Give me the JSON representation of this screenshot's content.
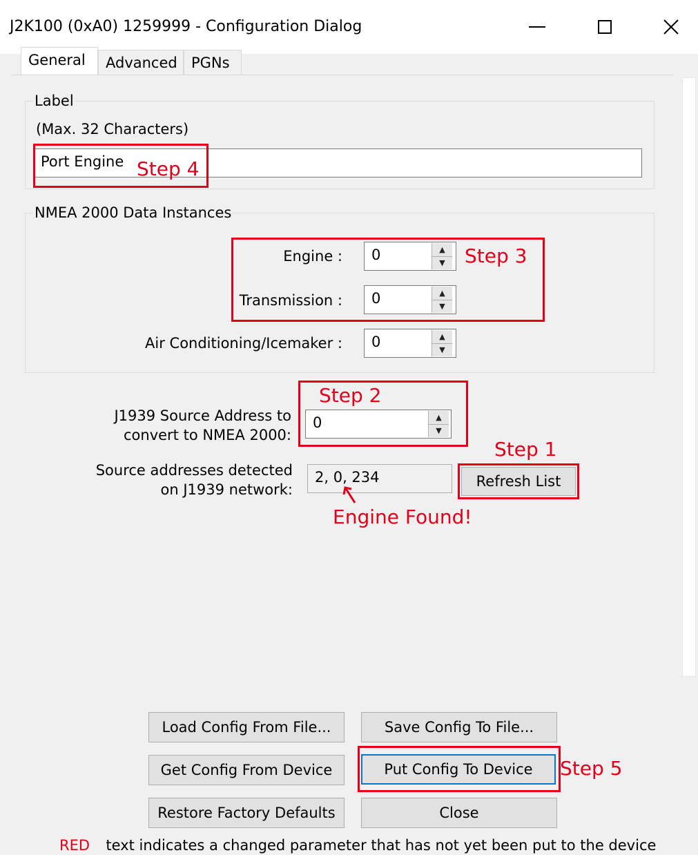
{
  "window": {
    "title": "J2K100 (0xA0) 1259999 - Configuration Dialog",
    "minimize_glyph": "—",
    "maximize_glyph": "☐",
    "close_glyph": "✕"
  },
  "tabs": [
    {
      "label": "General"
    },
    {
      "label": "Advanced"
    },
    {
      "label": "PGNs"
    }
  ],
  "label_group": {
    "title": "Label",
    "hint": "(Max. 32 Characters)",
    "value": "Port Engine"
  },
  "instances_group": {
    "title": "NMEA 2000 Data Instances",
    "engine_label": "Engine :",
    "engine_value": "0",
    "transmission_label": "Transmission :",
    "transmission_value": "0",
    "aircon_label": "Air Conditioning/Icemaker :",
    "aircon_value": "0"
  },
  "j1939": {
    "source_label_line1": "J1939 Source Address to",
    "source_label_line2": "convert to NMEA 2000:",
    "source_value": "0",
    "detected_label_line1": "Source addresses detected",
    "detected_label_line2": "on J1939 network:",
    "detected_value": "2, 0, 234",
    "refresh_label": "Refresh List"
  },
  "annotations": {
    "step1": "Step 1",
    "step2": "Step 2",
    "step3": "Step 3",
    "step4": "Step 4",
    "step5": "Step 5",
    "engine_found": "Engine Found!",
    "color": "#e2001a"
  },
  "buttons": {
    "load": "Load Config From File...",
    "save": "Save Config To File...",
    "get": "Get Config From Device",
    "put": "Put Config To Device",
    "restore": "Restore Factory Defaults",
    "close": "Close"
  },
  "legend": {
    "red_word": "RED",
    "text": "text indicates a changed parameter that has not yet been put to the device"
  }
}
